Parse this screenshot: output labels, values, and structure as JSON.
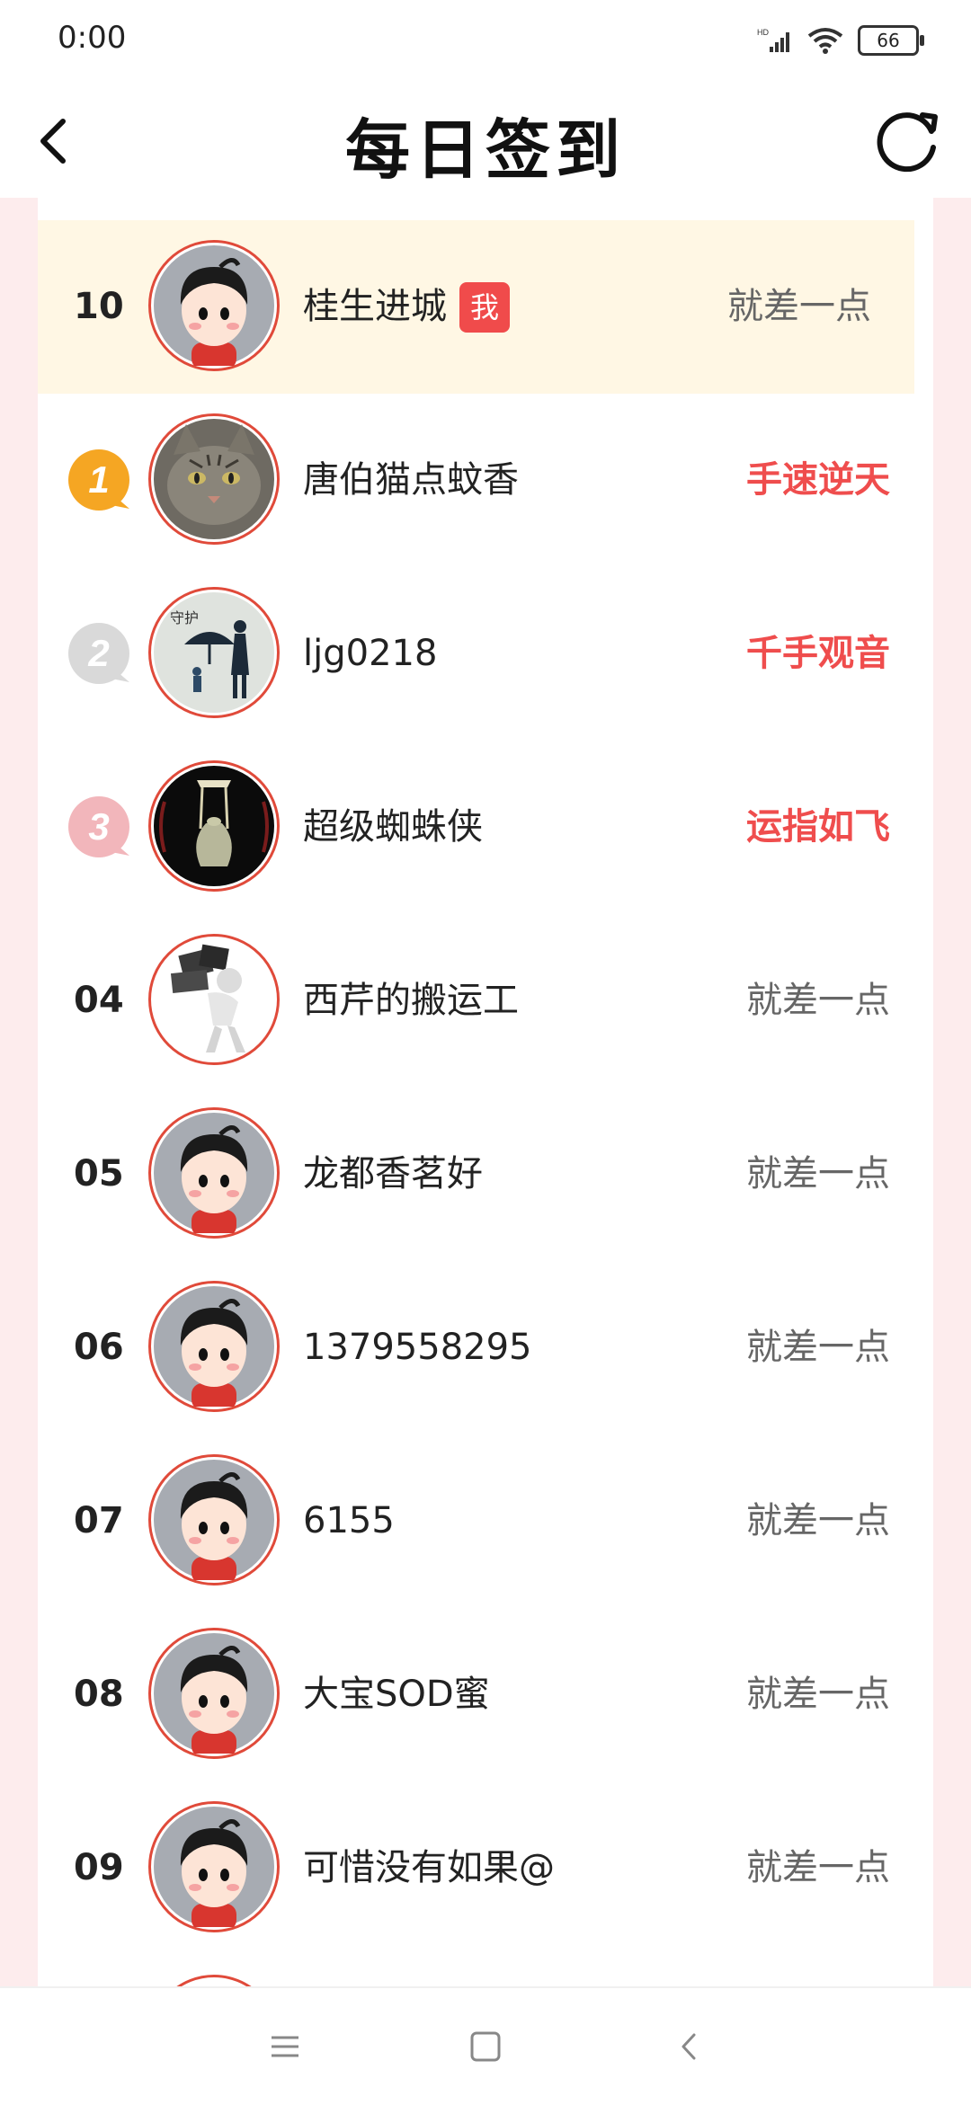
{
  "status_bar": {
    "time": "0:00",
    "battery": "66"
  },
  "header": {
    "title": "每日签到"
  },
  "me_badge": "我",
  "rows": [
    {
      "rank": "10",
      "name": "桂生进城",
      "status": "就差一点",
      "hot": false,
      "me": true,
      "avatar": "default-cartoon-boy"
    },
    {
      "rank": "1",
      "name": "唐伯猫点蚊香",
      "status": "手速逆天",
      "hot": true,
      "avatar": "cat-photo"
    },
    {
      "rank": "2",
      "name": "ljg0218",
      "status": "千手观音",
      "hot": true,
      "avatar": "umbrella-illustration"
    },
    {
      "rank": "3",
      "name": "超级蜘蛛侠",
      "status": "运指如飞",
      "hot": true,
      "avatar": "jade-vase"
    },
    {
      "rank": "04",
      "name": "西芹的搬运工",
      "status": "就差一点",
      "hot": false,
      "avatar": "3d-man-carrying-blocks"
    },
    {
      "rank": "05",
      "name": "龙都香茗好",
      "status": "就差一点",
      "hot": false,
      "avatar": "default-cartoon-boy"
    },
    {
      "rank": "06",
      "name": "1379558295",
      "status": "就差一点",
      "hot": false,
      "avatar": "default-cartoon-boy"
    },
    {
      "rank": "07",
      "name": "6155",
      "status": "就差一点",
      "hot": false,
      "avatar": "default-cartoon-boy"
    },
    {
      "rank": "08",
      "name": "大宝SOD蜜",
      "status": "就差一点",
      "hot": false,
      "avatar": "default-cartoon-boy"
    },
    {
      "rank": "09",
      "name": "可惜没有如果@",
      "status": "就差一点",
      "hot": false,
      "avatar": "default-cartoon-boy"
    }
  ],
  "colors": {
    "accent_red": "#ef4d4d",
    "gold": "#f5a623",
    "silver": "#d9d9d9",
    "bronze": "#f2b6bb",
    "me_highlight": "#fff7e4"
  }
}
